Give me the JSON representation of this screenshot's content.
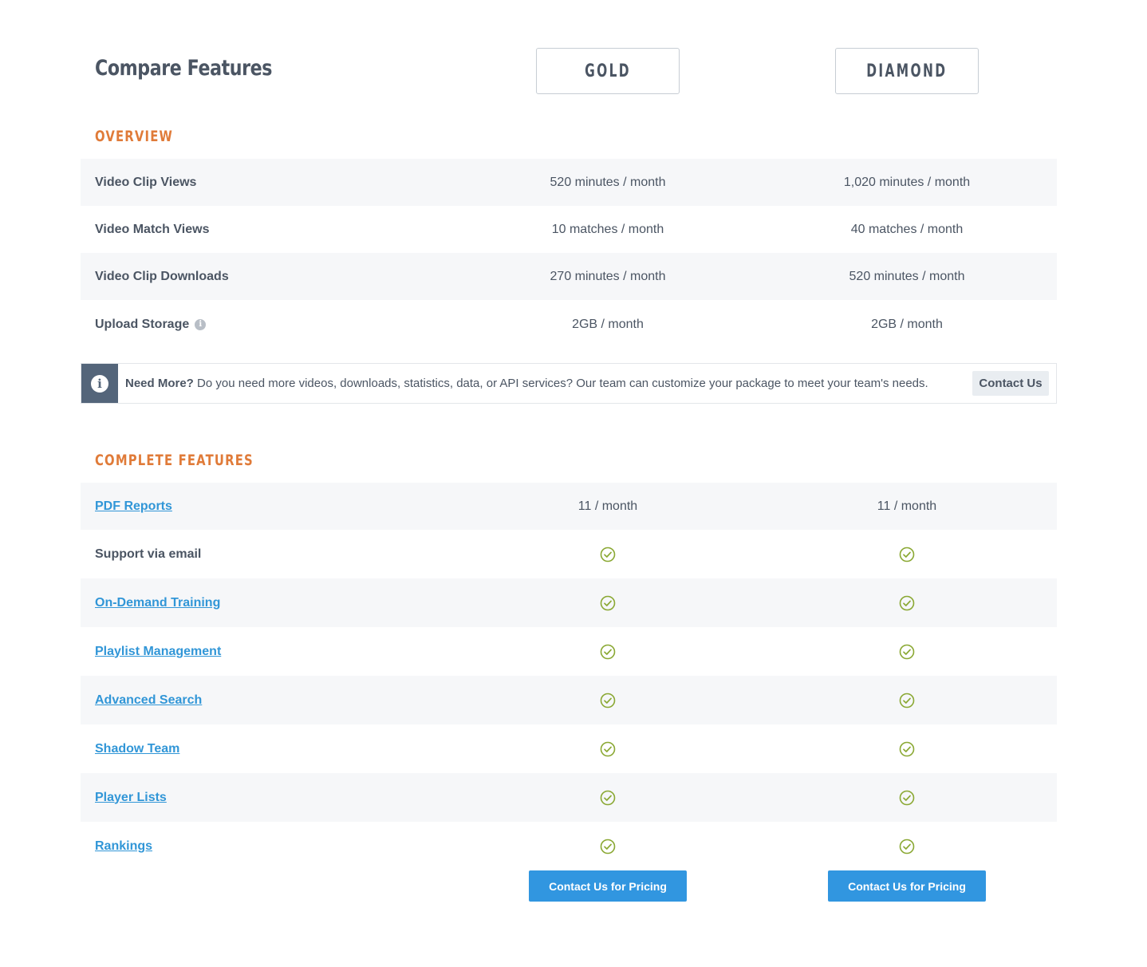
{
  "header": {
    "title": "Compare Features",
    "plans": [
      "GOLD",
      "DIAMOND"
    ]
  },
  "overview": {
    "title": "OVERVIEW",
    "rows": [
      {
        "label": "Video Clip Views",
        "gold": "520 minutes / month",
        "diamond": "1,020 minutes / month"
      },
      {
        "label": "Video Match Views",
        "gold": "10 matches / month",
        "diamond": "40 matches / month"
      },
      {
        "label": "Video Clip Downloads",
        "gold": "270 minutes / month",
        "diamond": "520 minutes / month"
      },
      {
        "label": "Upload Storage",
        "gold": "2GB / month",
        "diamond": "2GB / month",
        "info_icon": "info-icon"
      }
    ]
  },
  "notice": {
    "icon": "info-icon",
    "bold": "Need More?",
    "text": " Do you need more videos, downloads, statistics, data, or API services? Our team can customize your package to meet your team's needs.",
    "button": "Contact Us"
  },
  "complete": {
    "title": "COMPLETE FEATURES",
    "rows": [
      {
        "label": "PDF Reports",
        "link": true,
        "gold": "11 / month",
        "diamond": "11 / month"
      },
      {
        "label": "Support via email",
        "link": false,
        "gold": "check",
        "diamond": "check"
      },
      {
        "label": "On-Demand Training",
        "link": true,
        "gold": "check",
        "diamond": "check"
      },
      {
        "label": "Playlist Management",
        "link": true,
        "gold": "check",
        "diamond": "check"
      },
      {
        "label": "Advanced Search",
        "link": true,
        "gold": "check",
        "diamond": "check"
      },
      {
        "label": "Shadow Team",
        "link": true,
        "gold": "check",
        "diamond": "check"
      },
      {
        "label": "Player Lists",
        "link": true,
        "gold": "check",
        "diamond": "check"
      },
      {
        "label": "Rankings",
        "link": true,
        "gold": "check",
        "diamond": "check"
      }
    ]
  },
  "cta": {
    "gold": "Contact Us for Pricing",
    "diamond": "Contact Us for Pricing"
  },
  "colors": {
    "accent_orange": "#e07b39",
    "link_blue": "#3196d7",
    "button_blue": "#3196e0",
    "check_green": "#8aa833"
  }
}
